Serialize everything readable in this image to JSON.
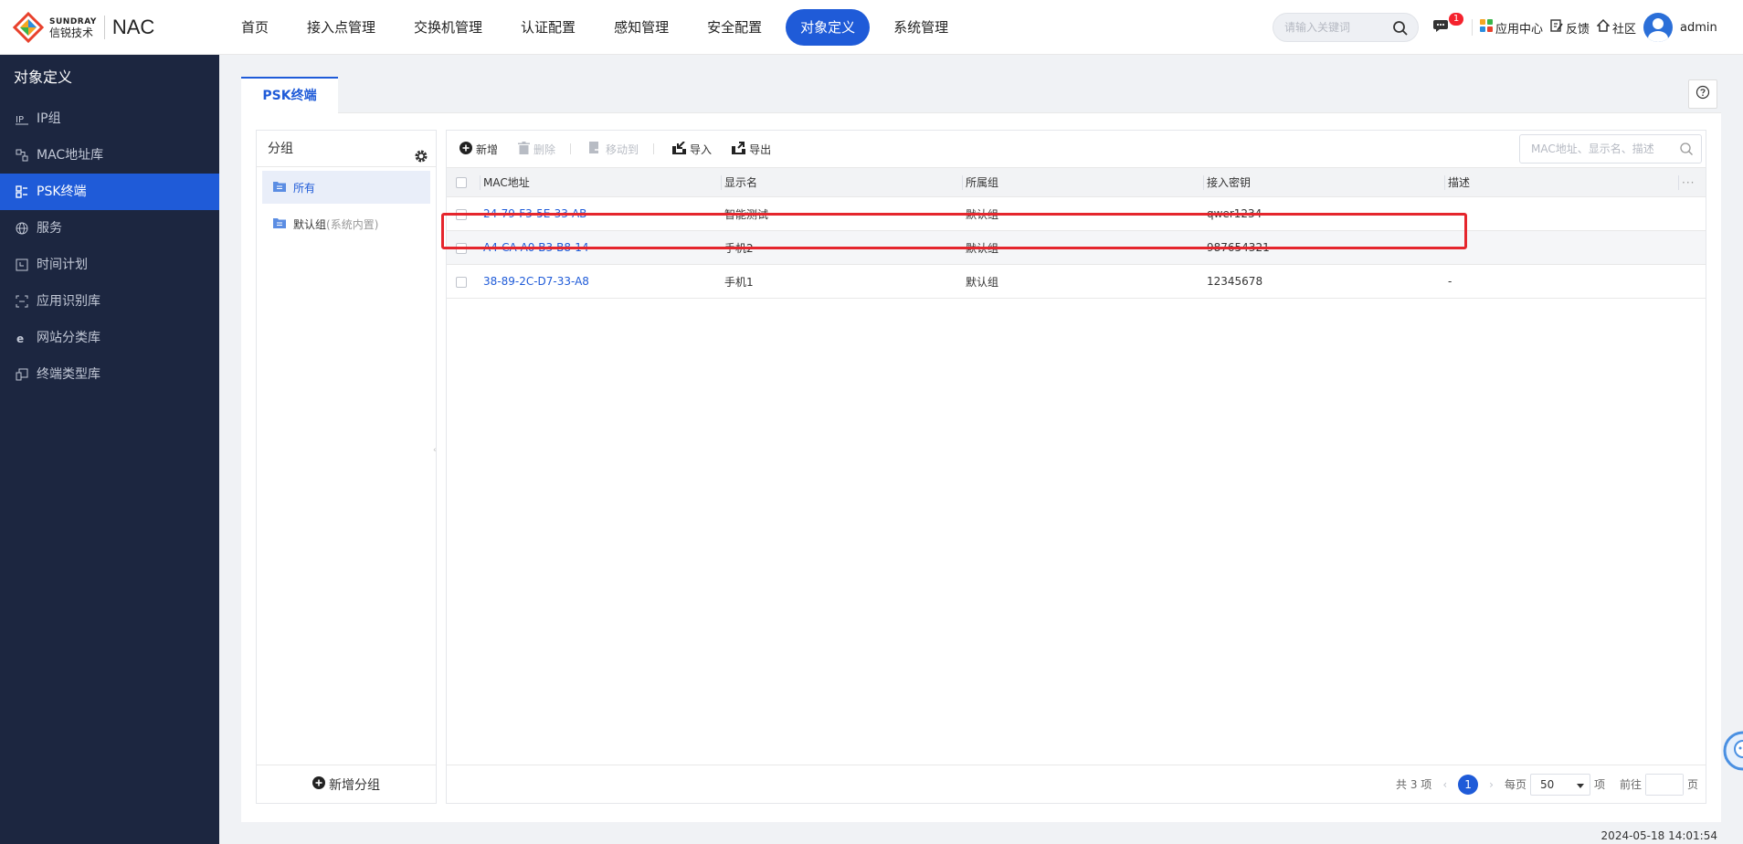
{
  "brand": {
    "en": "SUNDRAY",
    "cn": "信锐技术",
    "product": "NAC"
  },
  "nav": [
    {
      "label": "首页",
      "active": false
    },
    {
      "label": "接入点管理",
      "active": false
    },
    {
      "label": "交换机管理",
      "active": false
    },
    {
      "label": "认证配置",
      "active": false
    },
    {
      "label": "感知管理",
      "active": false
    },
    {
      "label": "安全配置",
      "active": false
    },
    {
      "label": "对象定义",
      "active": true
    },
    {
      "label": "系统管理",
      "active": false
    }
  ],
  "top_search": {
    "placeholder": "请输入关键词"
  },
  "top_tools": {
    "message_count": "1",
    "app_center": "应用中心",
    "feedback": "反馈",
    "community": "社区",
    "user": "admin"
  },
  "sidebar": {
    "title": "对象定义",
    "items": [
      {
        "label": "IP组",
        "icon": "ip-icon"
      },
      {
        "label": "MAC地址库",
        "icon": "mac-icon"
      },
      {
        "label": "PSK终端",
        "icon": "psk-icon",
        "active": true
      },
      {
        "label": "服务",
        "icon": "globe-icon"
      },
      {
        "label": "时间计划",
        "icon": "calendar-icon"
      },
      {
        "label": "应用识别库",
        "icon": "app-scan-icon"
      },
      {
        "label": "网站分类库",
        "icon": "web-icon"
      },
      {
        "label": "终端类型库",
        "icon": "device-icon"
      }
    ]
  },
  "tab": {
    "label": "PSK终端"
  },
  "groups": {
    "header": "分组",
    "items": [
      {
        "label": "所有",
        "suffix": ""
      },
      {
        "label": "默认组",
        "suffix": "(系统内置)"
      }
    ],
    "add_label": "新增分组"
  },
  "toolbar": {
    "add": "新增",
    "delete": "删除",
    "move": "移动到",
    "import": "导入",
    "export": "导出"
  },
  "table_search": {
    "placeholder": "MAC地址、显示名、描述"
  },
  "table": {
    "columns": [
      "MAC地址",
      "显示名",
      "所属组",
      "接入密钥",
      "描述"
    ],
    "rows": [
      {
        "mac": "24-79-F3-5E-33-AB",
        "name": "智能测试",
        "group": "默认组",
        "key": "qwer1234",
        "desc": "-"
      },
      {
        "mac": "A4-CA-A0-B3-B8-14",
        "name": "手机2",
        "group": "默认组",
        "key": "987654321",
        "desc": "-"
      },
      {
        "mac": "38-89-2C-D7-33-A8",
        "name": "手机1",
        "group": "默认组",
        "key": "12345678",
        "desc": "-"
      }
    ]
  },
  "pagination": {
    "total": "共 3 项",
    "current_page": "1",
    "per_page_label": "每页",
    "per_page": "50",
    "unit": "项",
    "goto_label": "前往",
    "goto_unit": "页"
  },
  "timestamp": "2024-05-18 14:01:54",
  "colors": {
    "accent": "#1f5bd8",
    "sidebar": "#1c2640",
    "highlight": "#e5262d"
  }
}
